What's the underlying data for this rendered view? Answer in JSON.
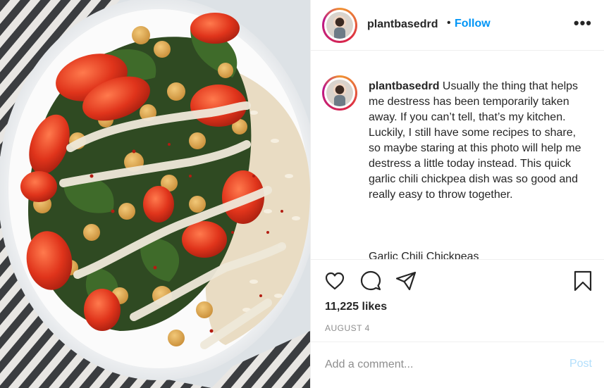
{
  "post": {
    "image_alt": "Garlic chili chickpea dish with kale, roasted tomatoes and rice",
    "author": {
      "username": "plantbasedrd",
      "dot": "•",
      "follow_label": "Follow",
      "more_icon": "more-options-icon",
      "more_glyph": "•••"
    },
    "caption": {
      "username": "plantbasedrd",
      "text": "Usually the thing that helps me destress has been temporarily taken away. If you can’t tell, that’s my kitchen. Luckily, I still have some recipes to share, so maybe staring at this photo will help me destress a little today instead. This quick garlic chili chickpea dish was so good and really easy to throw together.",
      "next_line": "Garlic Chili Chickpeas"
    },
    "actions": {
      "like_icon": "heart-icon",
      "comment_icon": "comment-icon",
      "share_icon": "share-icon",
      "save_icon": "bookmark-icon"
    },
    "likes": "11,225 likes",
    "date": "AUGUST 4",
    "comment": {
      "placeholder": "Add a comment...",
      "value": "",
      "post_label": "Post"
    }
  },
  "colors": {
    "link": "#0095f6",
    "post_disabled": "#b2dffc",
    "muted": "#8e8e8e",
    "text": "#262626"
  }
}
